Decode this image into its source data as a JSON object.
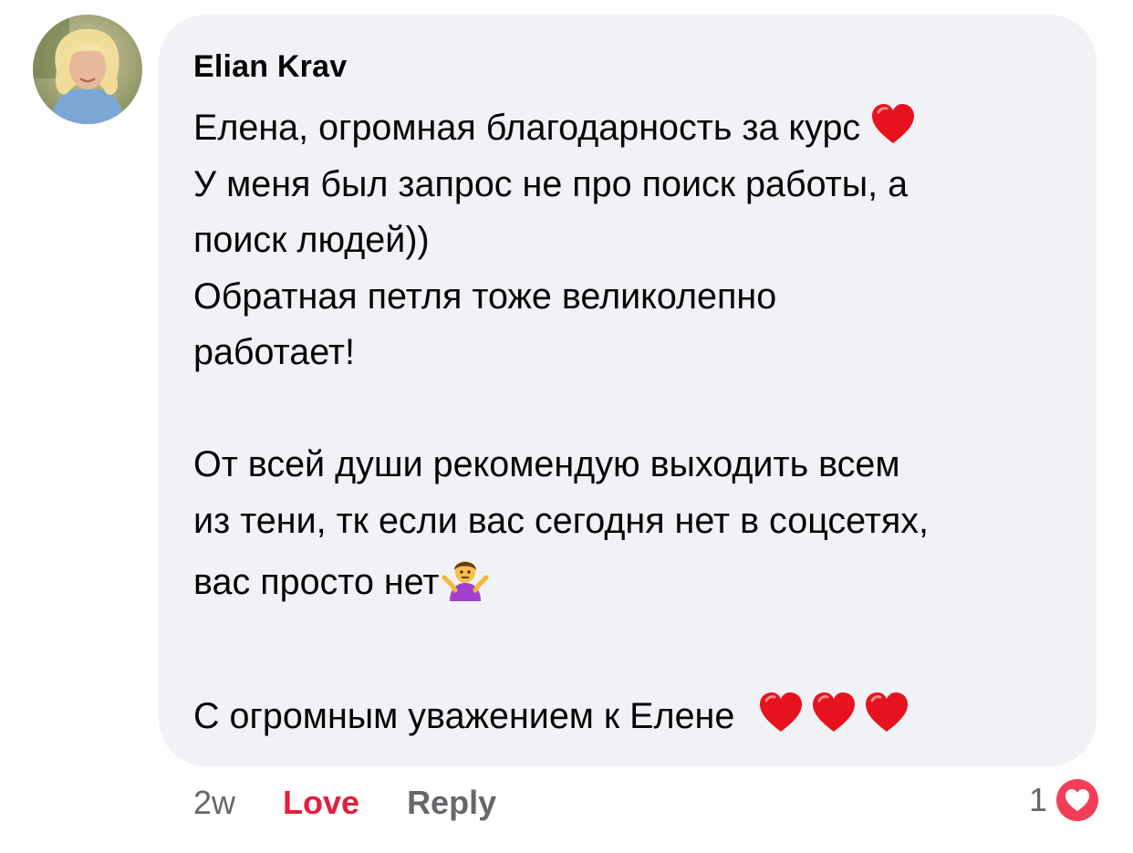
{
  "comment": {
    "author": "Elian Krav",
    "lines": [
      "Елена, огромная благодарность за курс",
      "У меня был запрос не про поиск работы, а",
      "поиск людей))",
      "Обратная петля тоже великолепно",
      "работает!",
      "",
      "От всей души рекомендую выходить всем",
      "из тени, тк если вас сегодня нет в соцсетях,",
      "вас просто нет"
    ],
    "signoff": "С огромным уважением к Елене",
    "emoji": {
      "line1_end": "red-heart",
      "line9_end": "person-shrugging",
      "signoff_end": [
        "red-heart",
        "red-heart",
        "red-heart"
      ]
    }
  },
  "actions": {
    "time": "2w",
    "love": "Love",
    "reply": "Reply"
  },
  "reactions": {
    "count": "1",
    "type": "love",
    "color": "#f33e58"
  },
  "colors": {
    "bubble": "#f0f2f5",
    "text": "#050505",
    "meta": "#65676b",
    "love": "#e41e3f"
  }
}
